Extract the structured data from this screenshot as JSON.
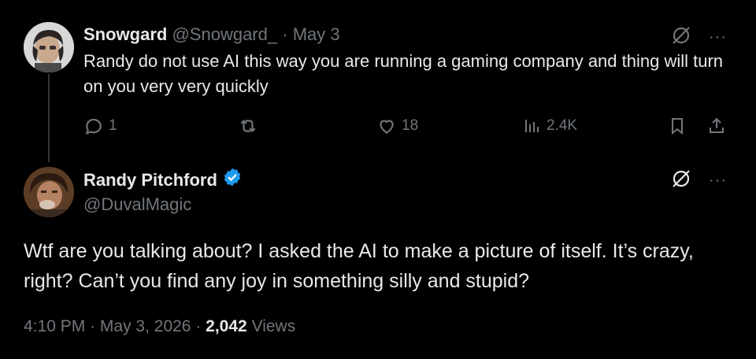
{
  "reply": {
    "display_name": "Snowgard",
    "handle": "@Snowgard_",
    "separator": "·",
    "date": "May 3",
    "text": "Randy do not use AI this way you are running a gaming company and thing will turn on you very very quickly",
    "actions": {
      "replies": "1",
      "reposts": "",
      "likes": "18",
      "views": "2.4K"
    },
    "more": "···"
  },
  "tweet": {
    "display_name": "Randy Pitchford",
    "handle": "@DuvalMagic",
    "text": "Wtf are you talking about? I asked the AI to make a picture of itself.  It’s crazy, right?  Can’t you find any joy in something silly and stupid?",
    "time": "4:10 PM",
    "date": "May 3, 2026",
    "views_count": "2,042",
    "views_label": "Views",
    "separator": "·",
    "more": "···"
  },
  "colors": {
    "background": "#000000",
    "text": "#e7e9ea",
    "secondary": "#71767b",
    "verified": "#1d9bf0",
    "thread_line": "#333639"
  },
  "icons": [
    "reply-icon",
    "repost-icon",
    "like-icon",
    "views-icon",
    "bookmark-icon",
    "share-icon",
    "grok-icon",
    "more-icon",
    "verified-badge-icon"
  ]
}
